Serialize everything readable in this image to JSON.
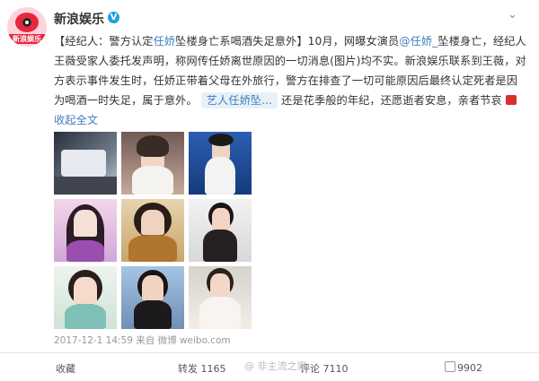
{
  "account": {
    "avatar_text": "新浪娱乐",
    "name": "新浪娱乐",
    "verified": "V"
  },
  "post": {
    "seg1": "【经纪人：警方认定",
    "mention1": "任娇",
    "seg2": "坠楼身亡系喝酒失足意外】10月，网曝女演员",
    "mention2": "@任娇_",
    "seg3": "坠楼身亡，经纪人王薇受家人委托发声明，称网传任娇离世原因的一切消息(图片)均不实。新浪娱乐联系到王薇，对方表示事件发生时，任娇正带着父母在外旅行，警方在排查了一切可能原因后最终认定死者是因为喝酒一时失足，属于意外。",
    "card_label": "艺人任娇坠...",
    "seg4": "还是花季般的年纪，还愿逝者安息，亲者节哀",
    "collapse": "收起全文"
  },
  "meta": {
    "timestamp": "2017-12-1 14:59",
    "source_prefix": "来自",
    "source": "微博 weibo.com"
  },
  "actions": {
    "favorite": "收藏",
    "repost": "转发 1165",
    "comment": "评论 7110",
    "like": "9902",
    "watermark": "@ 非主流之家"
  },
  "colors": {
    "link": "#3f7fbd",
    "accent": "#e8273f",
    "verified": "#1aa1e0"
  }
}
